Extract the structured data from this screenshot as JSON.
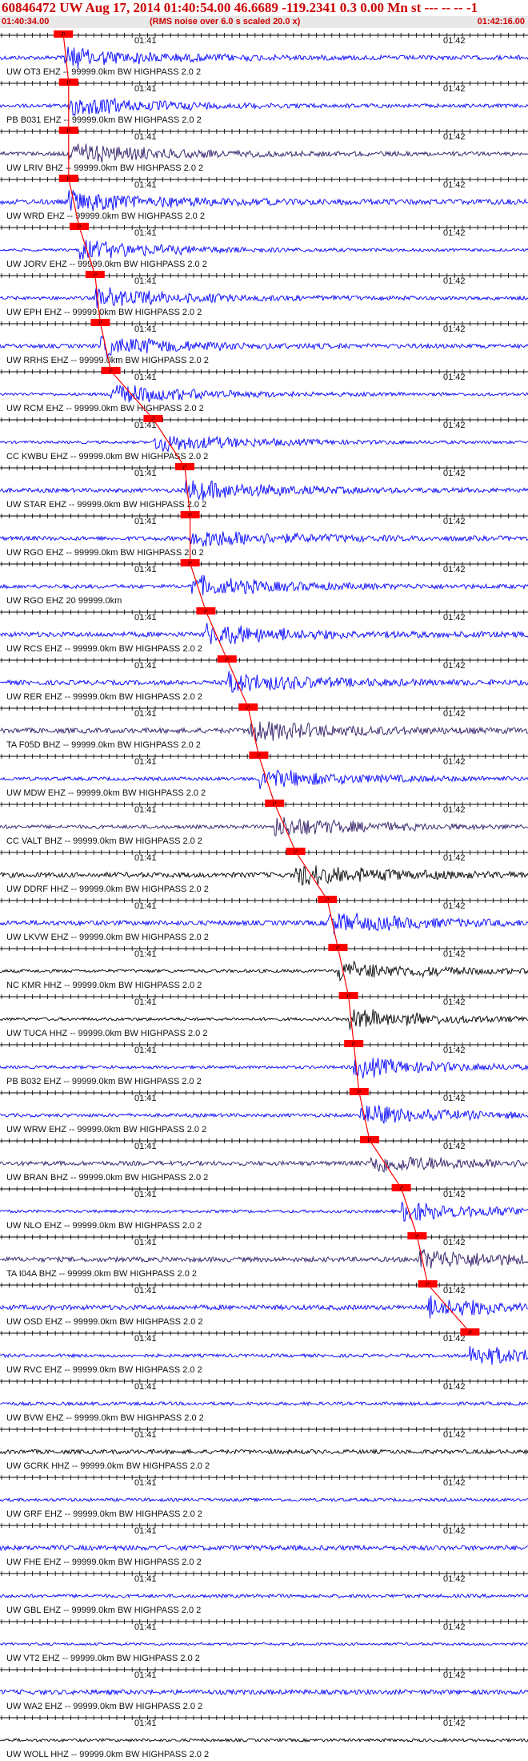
{
  "header": {
    "title": "60846472 UW Aug 17, 2014 01:40:54.00   46.6689 -119.2341  0.3 0.00 Mn st --- -- --   -1",
    "start_time": "01:40:34.00",
    "end_time": "01:42:16.00",
    "note": "(RMS noise over 6.0 s scaled 20.0 x)"
  },
  "chart_data": {
    "type": "seismogram",
    "time_labels": [
      "01:41",
      "01:42"
    ],
    "pick_label": "P",
    "colors": {
      "blue": "#0000ff",
      "purple": "#2e1a66",
      "black": "#000000",
      "pick": "#ff0000"
    },
    "channels": [
      {
        "label": "UW OT3 EHZ -- 99999.0km BW  HIGHPASS  2.0  2",
        "color": "blue",
        "pick": 0.12
      },
      {
        "label": "PB B031 EHZ -- 99999.0km BW  HIGHPASS  2.0  2",
        "color": "blue",
        "pick": 0.13
      },
      {
        "label": "UW LRIV BHZ -- 99999.0km BW  HIGHPASS  2.0  2",
        "color": "purple",
        "pick": 0.13
      },
      {
        "label": "UW WRD EHZ -- 99999.0km BW  HIGHPASS  2.0  2",
        "color": "blue",
        "pick": 0.13
      },
      {
        "label": "UW JORV EHZ -- 99999.0km BW  HIGHPASS  2.0  2",
        "color": "blue",
        "pick": 0.15
      },
      {
        "label": "UW EPH EHZ -- 99999.0km BW  HIGHPASS  2.0  2",
        "color": "blue",
        "pick": 0.18
      },
      {
        "label": "UW RRHS EHZ -- 99999.0km BW  HIGHPASS  2.0  2",
        "color": "blue",
        "pick": 0.19
      },
      {
        "label": "UW RCM EHZ -- 99999.0km BW  HIGHPASS  2.0  2",
        "color": "blue",
        "pick": 0.21
      },
      {
        "label": "CC KWBU EHZ -- 99999.0km BW  HIGHPASS  2.0  2",
        "color": "blue",
        "pick": 0.29
      },
      {
        "label": "UW STAR EHZ -- 99999.0km BW  HIGHPASS  2.0  2",
        "color": "blue",
        "pick": 0.35
      },
      {
        "label": "UW RGO EHZ -- 99999.0km BW  HIGHPASS  2.0  2",
        "color": "blue",
        "pick": 0.36
      },
      {
        "label": "UW RGO EHZ 20 99999.0km",
        "color": "blue",
        "pick": 0.36
      },
      {
        "label": "UW RCS EHZ -- 99999.0km BW  HIGHPASS  2.0  2",
        "color": "blue",
        "pick": 0.39
      },
      {
        "label": "UW RER EHZ -- 99999.0km BW  HIGHPASS  2.0  2",
        "color": "blue",
        "pick": 0.43
      },
      {
        "label": "TA F05D BHZ -- 99999.0km BW  HIGHPASS  2.0  2",
        "color": "purple",
        "pick": 0.47
      },
      {
        "label": "UW MDW EHZ -- 99999.0km BW  HIGHPASS  2.0  2",
        "color": "blue",
        "pick": 0.49
      },
      {
        "label": "CC VALT BHZ -- 99999.0km BW  HIGHPASS  2.0  2",
        "color": "purple",
        "pick": 0.52
      },
      {
        "label": "UW DDRF HHZ -- 99999.0km BW  HIGHPASS  2.0  2",
        "color": "black",
        "pick": 0.56
      },
      {
        "label": "UW LKVW EHZ -- 99999.0km BW  HIGHPASS  2.0  2",
        "color": "blue",
        "pick": 0.62
      },
      {
        "label": "NC KMR HHZ -- 99999.0km BW  HIGHPASS  2.0  2",
        "color": "black",
        "pick": 0.64
      },
      {
        "label": "UW TUCA HHZ -- 99999.0km BW  HIGHPASS  2.0  2",
        "color": "black",
        "pick": 0.66
      },
      {
        "label": "PB B032 EHZ -- 99999.0km BW  HIGHPASS  2.0  2",
        "color": "blue",
        "pick": 0.67
      },
      {
        "label": "UW WRW EHZ -- 99999.0km BW  HIGHPASS  2.0  2",
        "color": "blue",
        "pick": 0.68
      },
      {
        "label": "UW BRAN BHZ -- 99999.0km BW  HIGHPASS  2.0  2",
        "color": "purple",
        "pick": 0.7
      },
      {
        "label": "UW NLO EHZ -- 99999.0km BW  HIGHPASS  2.0  2",
        "color": "blue",
        "pick": 0.76
      },
      {
        "label": "TA I04A BHZ -- 99999.0km BW  HIGHPASS  2.0  2",
        "color": "purple",
        "pick": 0.79
      },
      {
        "label": "UW OSD EHZ -- 99999.0km BW  HIGHPASS  2.0  2",
        "color": "blue",
        "pick": 0.81
      },
      {
        "label": "UW RVC EHZ -- 99999.0km BW  HIGHPASS  2.0  2",
        "color": "blue",
        "pick": 0.89
      },
      {
        "label": "UW BVW EHZ -- 99999.0km BW  HIGHPASS  2.0  2",
        "color": "blue",
        "pick": null
      },
      {
        "label": "UW GCRK HHZ -- 99999.0km BW  HIGHPASS  2.0  2",
        "color": "black",
        "pick": null
      },
      {
        "label": "UW GRF EHZ -- 99999.0km BW  HIGHPASS  2.0  2",
        "color": "blue",
        "pick": null
      },
      {
        "label": "UW FHE EHZ -- 99999.0km BW  HIGHPASS  2.0  2",
        "color": "blue",
        "pick": null
      },
      {
        "label": "UW GBL EHZ -- 99999.0km BW  HIGHPASS  2.0  2",
        "color": "blue",
        "pick": null
      },
      {
        "label": "UW VT2 EHZ -- 99999.0km BW  HIGHPASS  2.0  2",
        "color": "blue",
        "pick": null
      },
      {
        "label": "UW WA2 EHZ -- 99999.0km BW  HIGHPASS  2.0  2",
        "color": "blue",
        "pick": null
      },
      {
        "label": "UW WOLL HHZ -- 99999.0km BW  HIGHPASS  2.0  2",
        "color": "black",
        "pick": null
      }
    ]
  }
}
